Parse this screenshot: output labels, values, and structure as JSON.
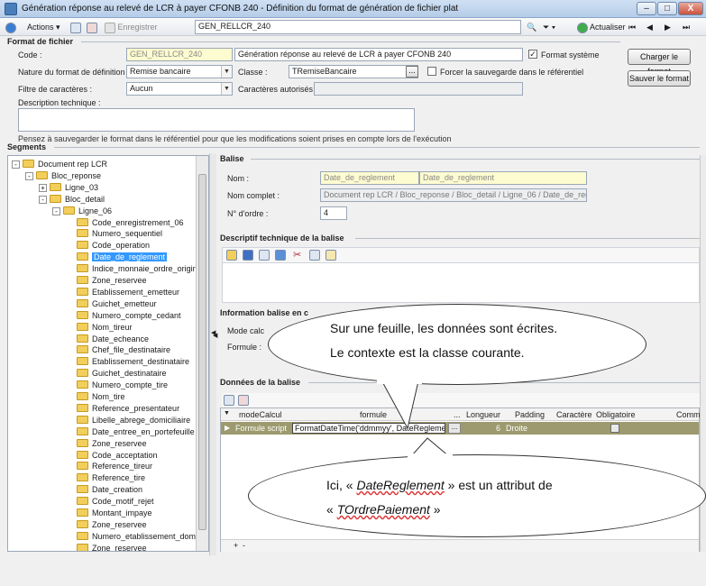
{
  "window": {
    "title": "Génération réponse au relevé de LCR à payer CFONB 240 -  Définition du format de génération de fichier plat",
    "minimize": "–",
    "maximize": "□",
    "close": "X"
  },
  "toolbar": {
    "actions": "Actions",
    "save": "Enregistrer",
    "search_value": "GEN_RELLCR_240",
    "refresh": "Actualiser"
  },
  "format": {
    "section": "Format de fichier",
    "code_label": "Code :",
    "code_value": "GEN_RELLCR_240",
    "description_value": "Génération réponse au relevé de LCR à payer CFONB 240",
    "system_label": "Format système",
    "nature_label": "Nature du format de définition :",
    "nature_value": "Remise bancaire",
    "class_label": "Classe :",
    "class_value": "TRemiseBancaire",
    "class_btn": "...",
    "force_label": "Forcer la sauvegarde dans le référentiel",
    "filter_label": "Filtre de caractères :",
    "filter_value": "Aucun",
    "allowed_label": "Caractères autorisés :",
    "tech_label": "Description technique :",
    "hint": "Pensez à sauvegarder le format dans le référentiel pour que les modifications soient prises en compte lors de l'exécution",
    "load_btn": "Charger le format",
    "save_btn": "Sauver le format"
  },
  "segments": {
    "section": "Segments",
    "tree": [
      {
        "label": "Document rep LCR",
        "exp": "-"
      },
      {
        "label": "Bloc_reponse",
        "exp": "-"
      },
      {
        "label": "Ligne_03",
        "exp": "+"
      },
      {
        "label": "Bloc_detail",
        "exp": "-"
      },
      {
        "label": "Ligne_06",
        "exp": "-"
      },
      {
        "label": "Code_enregistrement_06"
      },
      {
        "label": "Numero_sequentiel"
      },
      {
        "label": "Code_operation"
      },
      {
        "label": "Date_de_reglement"
      },
      {
        "label": "Indice_monnaie_ordre_origine"
      },
      {
        "label": "Zone_reservee"
      },
      {
        "label": "Etablissement_emetteur"
      },
      {
        "label": "Guichet_emetteur"
      },
      {
        "label": "Numero_compte_cedant"
      },
      {
        "label": "Nom_tireur"
      },
      {
        "label": "Date_echeance"
      },
      {
        "label": "Chef_file_destinataire"
      },
      {
        "label": "Etablissement_destinataire"
      },
      {
        "label": "Guichet_destinataire"
      },
      {
        "label": "Numero_compte_tire"
      },
      {
        "label": "Nom_tire"
      },
      {
        "label": "Reference_presentateur"
      },
      {
        "label": "Libelle_abrege_domiciliaire"
      },
      {
        "label": "Date_entree_en_portefeuille"
      },
      {
        "label": "Zone_reservee"
      },
      {
        "label": "Code_acceptation"
      },
      {
        "label": "Reference_tireur"
      },
      {
        "label": "Reference_tire"
      },
      {
        "label": "Date_creation"
      },
      {
        "label": "Code_motif_rejet"
      },
      {
        "label": "Montant_impaye"
      },
      {
        "label": "Zone_reservee"
      },
      {
        "label": "Numero_etablissement_domiciliataire"
      },
      {
        "label": "Zone_reservee"
      }
    ]
  },
  "balise": {
    "section": "Balise",
    "nom_label": "Nom :",
    "nom_value": "Date_de_reglement",
    "nom_value2": "Date_de_reglement",
    "complet_label": "Nom complet :",
    "complet_value": "Document rep LCR / Bloc_reponse / Bloc_detail / Ligne_06 / Date_de_reglement",
    "ordre_label": "N° d'ordre :",
    "ordre_value": "4"
  },
  "descriptif": {
    "section": "Descriptif technique de la balise"
  },
  "info": {
    "section": "Information balise en c",
    "mode_label": "Mode calc",
    "formule_label": "Formule :"
  },
  "donnees": {
    "section": "Données de la balise",
    "headers": [
      "modeCalcul",
      "formule",
      "...",
      "Longueur",
      "Padding",
      "Caractère",
      "Obligatoire",
      "Comme"
    ],
    "row": {
      "mode": "Formule script",
      "formule": "FormatDateTime('ddmmyy', DateReglement)",
      "dots": "...",
      "longueur": "6",
      "padding": "Droite",
      "caractere": "",
      "obligatoire": ""
    }
  },
  "callouts": {
    "top_line1": "Sur une feuille, les données sont écrites.",
    "top_line2": "Le contexte est la classe courante.",
    "bottom_pre": "Ici, « ",
    "bottom_attr": "DateReglement",
    "bottom_mid": " » est un attribut de",
    "bottom_pre2": "« ",
    "bottom_class": "TOrdrePaiement",
    "bottom_post2": " »"
  }
}
